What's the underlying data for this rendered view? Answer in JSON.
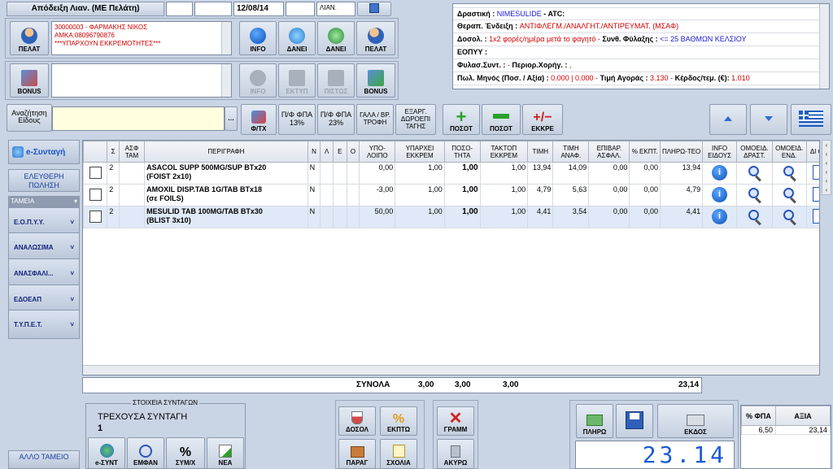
{
  "header": {
    "receipt_title": "Απόδειξη Λιαν. (ΜΕ Πελάτη)",
    "date": "12/08/14",
    "type_code": "ΛΙΑΝ."
  },
  "customer": {
    "button_label": "ΠΕΛΑΤ",
    "lines": [
      "30000003 - ΦΑΡΜΑΚΗΣ ΝΙΚΟΣ",
      "ΑΜΚΑ:08096790876",
      "***ΥΠΑΡΧΟΥΝ ΕΚΚΡΕΜΟΤΗΤΕΣ***"
    ],
    "actions": [
      "INFO",
      "ΔΑΝΕΙ",
      "ΔΑΝΕΙ",
      "ΠΕΛΑΤ"
    ]
  },
  "bonus": {
    "button_label": "BONUS",
    "actions": [
      "INFO",
      "ΕΚΤΥΠ",
      "ΠΙΣΤΩΣ",
      "BONUS"
    ]
  },
  "drug_info": {
    "active_label": "Δραστική :",
    "active_value": "NIMESULIDE",
    "atc_label": "ATC:",
    "indication_label": "Θεραπ. Ένδειξη :",
    "indication_value": "ΑΝΤΙΦΛΕΓΜ./ΑΝΑΛΓΗΤ./ΑΝΤΙΡΕΥΜΑΤ. (ΜΣΑΦ)",
    "dosage_label": "Δοσολ. :",
    "dosage_value": "1x2 φορές/ημέρα μετά το φαγητό -",
    "storage_label": "Συνθ. Φύλαξης :",
    "storage_value": "<= 25 ΒΑΘΜΩΝ ΚΕΛΣΙΟΥ",
    "eopyy_label": "ΕΟΠΥΥ :",
    "guard_label": "Φυλασ.Συντ. :",
    "guard_value": "-",
    "restrict_label": "Περιορ.Χορήγ. :",
    "restrict_value": ",",
    "sales_label": "Πωλ. Μηνός (Ποσ. / Αξία) :",
    "sales_value": "0.000 | 0.000 -",
    "buy_label": "Τιμή Αγοράς :",
    "buy_value": "3.130 -",
    "profit_label": "Κέρδος/τεμ. (€):",
    "profit_value": "1.010"
  },
  "search": {
    "label": "Αναζήτηση Είδους",
    "value": "",
    "buttons": [
      "Φ/ΤΧ",
      "Π/Φ ΦΠΑ 13%",
      "Π/Φ ΦΠΑ 23%",
      "ΓΑΛΑ / ΒΡ. ΤΡΟΦΗ",
      "ΕΞΑΡΓ. ΔΩΡΟΕΠΙ ΤΑΓΗΣ"
    ],
    "qty_buttons": [
      "ΠΟΣΟΤ",
      "ΠΟΣΟΤ",
      "ΕΚΚΡΕ"
    ]
  },
  "sidebar": {
    "esyntagi": "e-Συνταγή",
    "free_sale": "ΕΛΕΥΘΕΡΗ ΠΩΛΗΣΗ",
    "funds_header": "ΤΑΜΕΙΑ",
    "funds": [
      "Ε.Ο.Π.Υ.Υ.",
      "ΑΝΑΛΩΣΙΜΑ",
      "ΑΝΑΣΦΑΛΙ...",
      "ΕΔΟΕΑΠ",
      "Τ.Υ.Π.Ε.Τ."
    ],
    "other_fund": "ΑΛΛΟ ΤΑΜΕΙΟ"
  },
  "grid": {
    "columns": [
      "",
      "Σ",
      "ΑΣΦ ΤΑΜ",
      "ΠΕΡΙΓΡΑΦΗ",
      "Ν",
      "Λ",
      "Ε",
      "Ο",
      "ΥΠΟ-ΛΟΙΠΟ",
      "ΥΠΑΡΧΕΙ ΕΚΚΡΕΜ",
      "ΠΟΣΟ-ΤΗΤΑ",
      "ΤΑΚΤΟΠ ΕΚΚΡΕΜ",
      "ΤΙΜΗ",
      "ΤΙΜΗ ΑΝΑΦ.",
      "ΕΠΙΒΑΡ. ΑΣΦΑΛ.",
      "% ΕΚΠΤ.",
      "ΠΛΗΡΩ-ΤΕΟ",
      "INFO ΕΙΔΟΥΣ",
      "ΟΜΟΕΙΔ. ΔΡΑΣΤ.",
      "ΟΜΟΕΙΔ. ΕΝΔ.",
      "ΔΙ ΘΣ"
    ],
    "rows": [
      {
        "s": "2",
        "desc1": "ASACOL SUPP 500MG/SUP BTx20",
        "desc2": "(FOIST 2x10)",
        "n": "N",
        "rem": "0,00",
        "pend": "1,00",
        "qty": "1,00",
        "tpend": "1,00",
        "price": "13,94",
        "ref": "14,09",
        "ins": "0,00",
        "disc": "0,00",
        "pay": "13,94"
      },
      {
        "s": "2",
        "desc1": "AMOXIL DISP.TAB 1G/TAB BTx18",
        "desc2": "(σε FOILS)",
        "n": "N",
        "rem": "-3,00",
        "pend": "1,00",
        "qty": "1,00",
        "tpend": "1,00",
        "price": "4,79",
        "ref": "5,63",
        "ins": "0,00",
        "disc": "0,00",
        "pay": "4,79"
      },
      {
        "s": "2",
        "desc1": "MESULID TAB 100MG/TAB BTx30",
        "desc2": "(BLIST 3x10)",
        "n": "N",
        "rem": "50,00",
        "pend": "1,00",
        "qty": "1,00",
        "tpend": "1,00",
        "price": "4,41",
        "ref": "3,54",
        "ins": "0,00",
        "disc": "0,00",
        "pay": "4,41"
      }
    ],
    "totals_label": "ΣΥΝΟΛΑ",
    "total_pend": "3,00",
    "total_qty": "3,00",
    "total_tpend": "3,00",
    "total_pay": "23,14"
  },
  "prescription": {
    "group_title": "ΣΤΟΙΧΕΙΑ ΣΥΝΤΑΓΩΝ",
    "current_label": "ΤΡΕΧΟΥΣΑ ΣΥΝΤΑΓΗ",
    "current_value": "1",
    "buttons": [
      "e-ΣΥΝΤ",
      "ΕΜΦΑΝ",
      "ΣΥΜ/Χ",
      "ΝΕΑ"
    ]
  },
  "mid_buttons": [
    "ΔΟΣΟΛ",
    "ΕΚΠΤΩ",
    "ΠΑΡΑΓ",
    "ΣΧΟΛΙΑ"
  ],
  "line_buttons": [
    "ΓΡΑΜΜ",
    "ΑΚΥΡΩ"
  ],
  "pay_buttons": [
    "ΠΛΗΡΩ",
    "",
    "ΕΚΔΟΣ"
  ],
  "display_total": "23.14",
  "vat_table": {
    "headers": [
      "% ΦΠΑ",
      "ΑΞΙΑ"
    ],
    "rows": [
      [
        "6,50",
        "23,14"
      ]
    ]
  },
  "colors": {
    "accent_red": "#d00000",
    "accent_blue": "#1a1ad0",
    "display_text": "#1c5bd6"
  }
}
